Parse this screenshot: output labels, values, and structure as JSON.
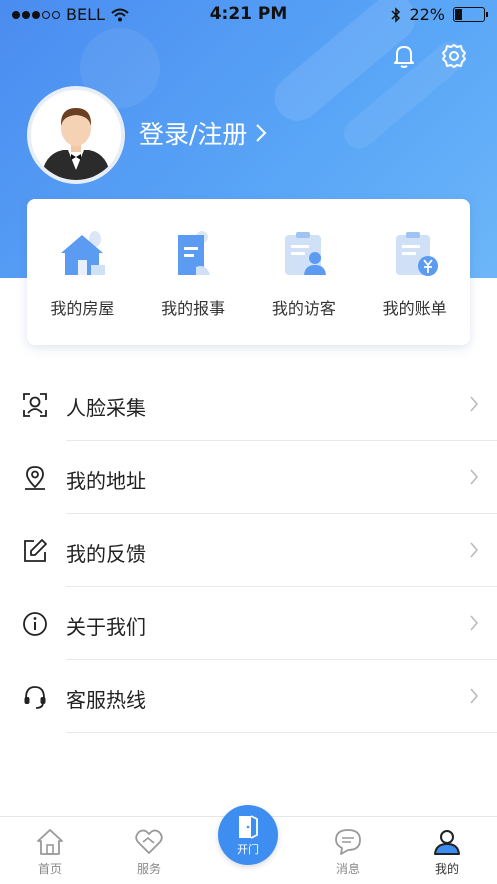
{
  "status_bar": {
    "carrier": "BELL",
    "time": "4:21 PM",
    "battery": "22%"
  },
  "header": {
    "login_label": "登录/注册"
  },
  "quick_actions": [
    {
      "label": "我的房屋",
      "icon": "house-icon"
    },
    {
      "label": "我的报事",
      "icon": "report-doc-icon"
    },
    {
      "label": "我的访客",
      "icon": "visitor-icon"
    },
    {
      "label": "我的账单",
      "icon": "bill-icon"
    }
  ],
  "menu": [
    {
      "label": "人脸采集",
      "icon": "face-scan-icon"
    },
    {
      "label": "我的地址",
      "icon": "location-pin-icon"
    },
    {
      "label": "我的反馈",
      "icon": "edit-icon"
    },
    {
      "label": "关于我们",
      "icon": "info-icon"
    },
    {
      "label": "客服热线",
      "icon": "headset-icon"
    }
  ],
  "tabbar": {
    "home": "首页",
    "service": "服务",
    "open_door": "开门",
    "messages": "消息",
    "mine": "我的",
    "active": "mine"
  },
  "colors": {
    "accent": "#3d8ef0",
    "header_start": "#4a8cf0",
    "header_end": "#6cb6f8"
  }
}
